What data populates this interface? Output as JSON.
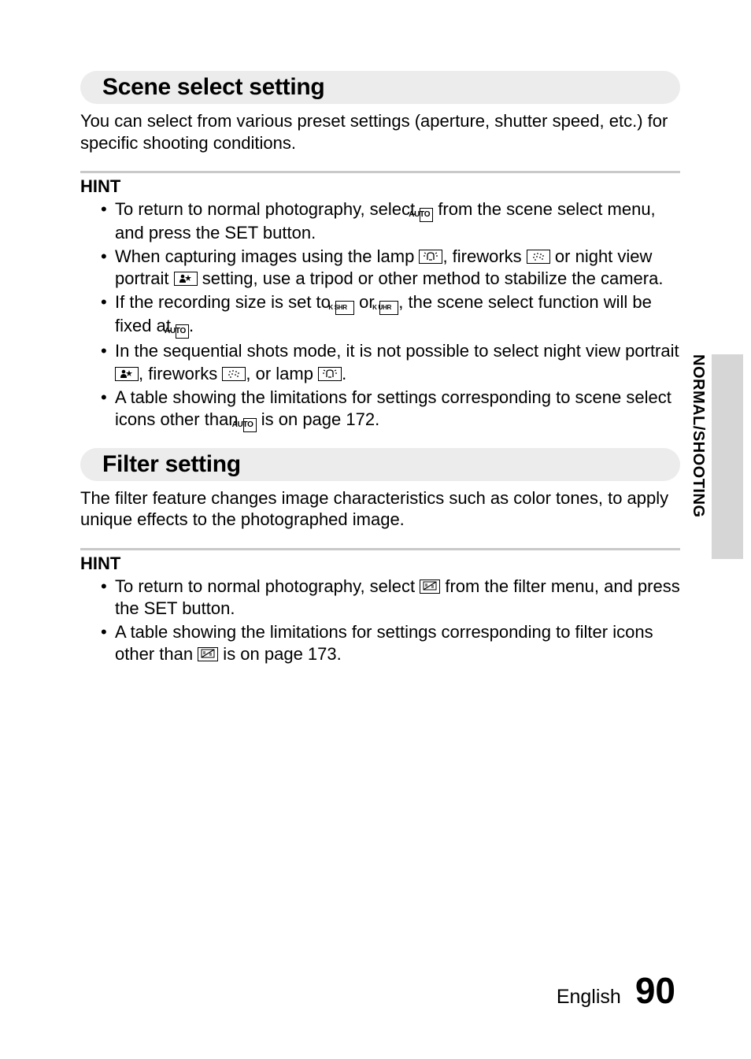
{
  "sections": {
    "scene": {
      "title": "Scene select setting",
      "body": "You can select from various preset settings (aperture, shutter speed, etc.) for specific shooting conditions.",
      "hint_label": "HINT",
      "bullets": {
        "b1a": "To return to normal photography, select ",
        "b1b": " from the scene select menu, and press the SET button.",
        "b2a": "When capturing images using the lamp ",
        "b2b": ", fireworks ",
        "b2c": " or night view portrait ",
        "b2d": " setting, use a tripod or other method to stabilize the camera.",
        "b3a": "If the recording size is set to ",
        "b3b": " or ",
        "b3c": ", the scene select function will be fixed at ",
        "b3d": ".",
        "b4a": "In the sequential shots mode, it is not possible to select night view portrait ",
        "b4b": ", fireworks ",
        "b4c": ", or lamp ",
        "b4d": ".",
        "b5a": "A table showing the limitations for settings corresponding to scene select icons other than ",
        "b5b": " is on page 172."
      }
    },
    "filter": {
      "title": "Filter setting",
      "body": "The filter feature changes image characteristics such as color tones, to apply unique effects to the photographed image.",
      "hint_label": "HINT",
      "bullets": {
        "b1a": "To return to normal photography, select ",
        "b1b": " from the filter menu, and press the SET button.",
        "b2a": "A table showing the limitations for settings corresponding to filter icons other than ",
        "b2b": " is on page 173."
      }
    }
  },
  "icons": {
    "auto": "AUTO",
    "shr": "K SHR",
    "uhr": "K UHR"
  },
  "side_label": "NORMAL/SHOOTING",
  "footer": {
    "lang": "English",
    "page": "90"
  }
}
